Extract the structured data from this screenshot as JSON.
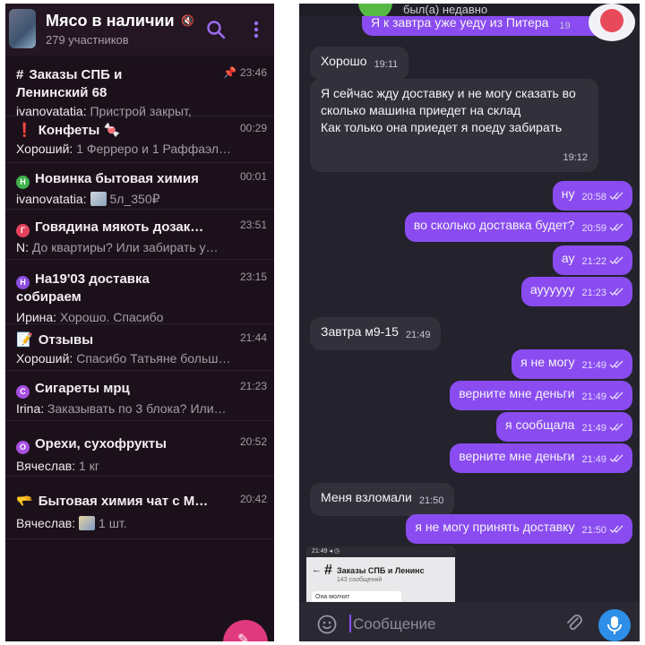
{
  "left_panel": {
    "title": "Мясо в наличии",
    "subtitle": "279 участников",
    "chats": [
      {
        "symbol": "#",
        "title_line1": "Заказы СПБ и",
        "title_line2": "Ленинский 68",
        "time": "23:46",
        "pinned": true,
        "sender": "ivanovatatia:",
        "preview": " Пристрой закрыт,"
      },
      {
        "symbol": "❗",
        "title_line1": "Конфеты 🍬",
        "time": "00:29",
        "sender": "Хороший:",
        "preview": " 1 Ферреро и 1 Раффаэл…"
      },
      {
        "badge_text": "Н",
        "badge_color": "#3fb14a",
        "title_line1": "Новинка бытовая химия",
        "time": "00:01",
        "sender": "ivanovatatia:",
        "preview": "5л_350₽",
        "has_thumb": true
      },
      {
        "badge_text": "Г",
        "badge_color": "#e5435c",
        "title_line1": "Говядина мякоть дозак…",
        "time": "23:51",
        "sender": "N:",
        "preview": " До квартиры? Или забирать у…"
      },
      {
        "badge_text": "Н",
        "badge_color": "#8d4de0",
        "title_line1": "На19'03 доставка",
        "title_line2": "собираем",
        "time": "23:15",
        "sender": "Ирина:",
        "preview": " Хорошо. Спасибо"
      },
      {
        "symbol": "📝",
        "title_line1": "Отзывы",
        "time": "21:44",
        "sender": "Хороший:",
        "preview": " Спасибо Татьяне больш…"
      },
      {
        "badge_text": "С",
        "badge_color": "#a74fe0",
        "title_line1": "Сигареты мрц",
        "time": "21:23",
        "sender": "Irina:",
        "preview": " Заказывать по 3 блока? Или…"
      },
      {
        "badge_text": "О",
        "badge_color": "#a74fe0",
        "title_line1": "Орехи, сухофрукты",
        "time": "20:52",
        "sender": "Вячеслав:",
        "preview": " 1 кг"
      },
      {
        "symbol": "🫳",
        "title_line1": "Бытовая химия чат с М…",
        "time": "20:42",
        "sender": "Вячеслав:",
        "preview": "1 шт.",
        "has_thumb": true
      }
    ]
  },
  "right_panel": {
    "status": "был(а) недавно",
    "clipped_message": "Я к завтра уже уеду из Питера",
    "clipped_time": "19",
    "messages": [
      {
        "dir": "in",
        "text": "Хорошо",
        "time": "19:11"
      },
      {
        "dir": "in",
        "multi": true,
        "text": "Я сейчас жду доставку и не могу сказать во сколько машина приедет на склад\nКак только она приедет я поеду забирать",
        "time": "19:12"
      },
      {
        "dir": "out",
        "text": "ну",
        "time": "20:58"
      },
      {
        "dir": "out",
        "text": "во сколько доставка будет?",
        "time": "20:59"
      },
      {
        "dir": "out",
        "text": "ау",
        "time": "21:22"
      },
      {
        "dir": "out",
        "text": "ауууууу",
        "time": "21:23"
      },
      {
        "dir": "in",
        "text": "Завтра м9-15",
        "time": "21:49"
      },
      {
        "dir": "out",
        "text": "я не могу",
        "time": "21:49"
      },
      {
        "dir": "out",
        "text": "верните мне деньги",
        "time": "21:49"
      },
      {
        "dir": "out",
        "text": "я сообщала",
        "time": "21:49"
      },
      {
        "dir": "out",
        "text": "верните мне деньги",
        "time": "21:49"
      },
      {
        "dir": "in",
        "text": "Меня взломали",
        "time": "21:50"
      },
      {
        "dir": "out",
        "text": "я не могу принять доставку",
        "time": "21:50"
      }
    ],
    "preview_card": {
      "statusbar": "21:49 ◂ ◷",
      "title": "Заказы СПБ и Ленинс",
      "subtitle": "143 сообщений",
      "message": "Она молчит"
    },
    "input_placeholder": "Сообщение"
  },
  "colors": {
    "accent": "#8a4cf0",
    "left_bg": "#1c111b",
    "right_bg": "#24232d",
    "incoming_bubble": "#32313b",
    "fab_pink": "#e0397d",
    "mic_blue": "#2d8fe8"
  }
}
